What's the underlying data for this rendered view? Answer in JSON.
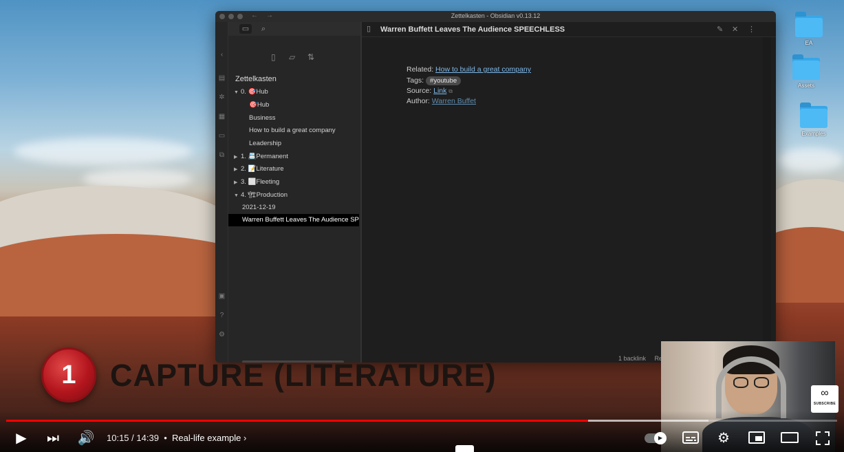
{
  "desktop": {
    "icons": [
      {
        "label": "EA"
      },
      {
        "label": "Assets"
      },
      {
        "label": "Examples"
      }
    ]
  },
  "obsidian": {
    "window_title": "Zettelkasten - Obsidian v0.13.12",
    "vault_name": "Zettelkasten",
    "tree": [
      {
        "label": "0. 🎯Hub",
        "expanded": true
      },
      {
        "label": "🎯Hub"
      },
      {
        "label": "Business"
      },
      {
        "label": "How to build a great company"
      },
      {
        "label": "Leadership"
      },
      {
        "label": "1. 📇Permanent",
        "expanded": false
      },
      {
        "label": "2. 📝Literature",
        "expanded": false
      },
      {
        "label": "3. ⬜Fleeting",
        "expanded": false
      },
      {
        "label": "4. 🏗Production",
        "expanded": true
      },
      {
        "label": "2021-12-19"
      },
      {
        "label": "Warren Buffett Leaves The Audience SP"
      }
    ],
    "note": {
      "title": "Warren Buffett Leaves The Audience SPEECHLESS",
      "related_label": "Related:",
      "related_link": "How to build a great company",
      "tags_label": "Tags:",
      "tag": "#youtube",
      "source_label": "Source:",
      "source_link": "Link",
      "author_label": "Author:",
      "author_link": "Warren Buffet"
    },
    "status": {
      "backlinks": "1 backlink",
      "mode": "Rea"
    }
  },
  "overlay": {
    "number": "1",
    "title": "CAPTURE (LITERATURE)"
  },
  "subscribe": {
    "label": "SUBSCRIBE"
  },
  "player": {
    "current_time": "10:15",
    "duration": "14:39",
    "separator": "/",
    "chapter": "Real-life example",
    "progress_played": 0.7,
    "progress_loaded": 0.845,
    "colors": {
      "played": "#ff0000"
    }
  }
}
